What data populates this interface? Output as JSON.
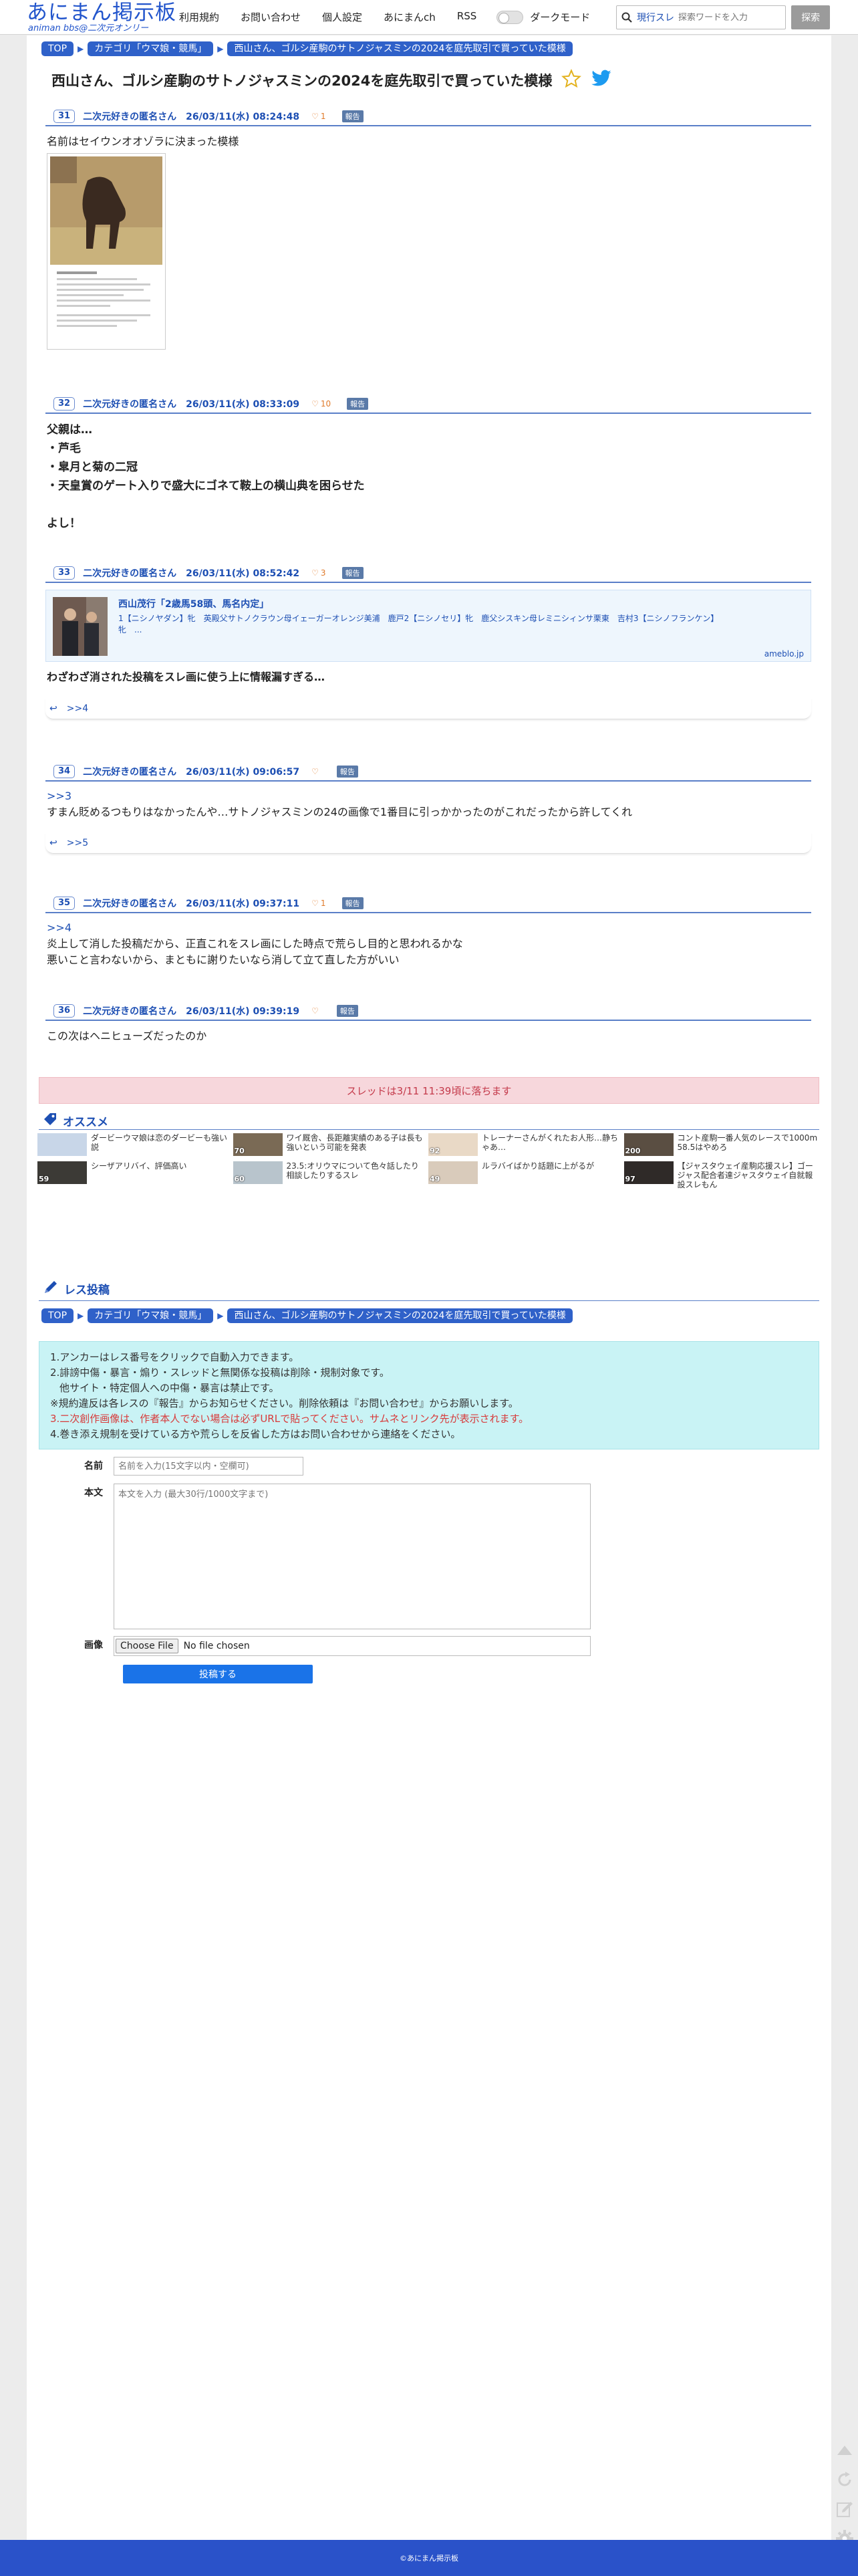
{
  "header": {
    "logo_main": "あにまん掲示板",
    "logo_sub": "animan bbs@二次元オンリー",
    "nav": [
      "利用規約",
      "お問い合わせ",
      "個人設定",
      "あにまんch",
      "RSS"
    ],
    "dark_mode": "ダークモード",
    "search_select": "現行スレ",
    "search_placeholder": "探索ワードを入力",
    "search_button": "探索"
  },
  "breadcrumb": {
    "top": "TOP",
    "category": "カテゴリ「ウマ娘・競馬」",
    "thread": "西山さん、ゴルシ産駒のサトノジャスミンの2024を庭先取引で買っていた模様"
  },
  "thread_title": "西山さん、ゴルシ産駒のサトノジャスミンの2024を庭先取引で買っていた模様",
  "report_label": "報告",
  "posts": [
    {
      "no": "31",
      "name": "二次元好きの匿名さん",
      "date": "26/03/11(水) 08:24:48",
      "likes": "1",
      "lines": [
        "名前はセイウンオオゾラに決まった模様"
      ]
    },
    {
      "no": "32",
      "name": "二次元好きの匿名さん",
      "date": "26/03/11(水) 08:33:09",
      "likes": "10",
      "lines": [
        "父親は…",
        "・芦毛",
        "・皐月と菊の二冠",
        "・天皇賞のゲート入りで盛大にゴネて鞍上の横山典を困らせた",
        "",
        "よし！"
      ]
    },
    {
      "no": "33",
      "name": "二次元好きの匿名さん",
      "date": "26/03/11(水) 08:52:42",
      "likes": "3",
      "lines": [
        "わざわざ消された投稿をスレ画に使う上に情報漏すぎる…"
      ],
      "reply": ">>4"
    },
    {
      "no": "34",
      "name": "二次元好きの匿名さん",
      "date": "26/03/11(水) 09:06:57",
      "likes": "",
      "anchor": ">>3",
      "lines": [
        "すまん貶めるつもりはなかったんや…サトノジャスミンの24の画像で1番目に引っかかったのがこれだったから許してくれ"
      ],
      "reply": ">>5"
    },
    {
      "no": "35",
      "name": "二次元好きの匿名さん",
      "date": "26/03/11(水) 09:37:11",
      "likes": "1",
      "anchor": ">>4",
      "lines": [
        "炎上して消した投稿だから、正直これをスレ画にした時点で荒らし目的と思われるかな",
        "悪いこと言わないから、まともに謝りたいなら消して立て直した方がいい"
      ]
    },
    {
      "no": "36",
      "name": "二次元好きの匿名さん",
      "date": "26/03/11(水) 09:39:19",
      "likes": "",
      "lines": [
        "この次はヘニヒューズだったのか"
      ]
    }
  ],
  "link_card": {
    "title": "西山茂行「2歳馬58頭、馬名内定」",
    "desc": "1【ニシノヤダン】牝　英殿父サトノクラウン母イェーガーオレンジ美浦　鹿戸2【ニシノセリ】牝　鹿父シスキン母レミニシィンサ栗東　吉村3【ニシノフランケン】牝　...",
    "domain": "ameblo.jp"
  },
  "falls_notice": "スレッドは3/11 11:39頃に落ちます",
  "recommend": {
    "heading": "オススメ",
    "items": [
      {
        "count": "",
        "title": "ダービーウマ娘は恋のダービーも強い説",
        "color": "#c8d6e8"
      },
      {
        "count": "70",
        "title": "ワイ厩舎、長距離実績のある子は長も強いという可能を発表",
        "color": "#7a6a55"
      },
      {
        "count": "92",
        "title": "トレーナーさんがくれたお人形…静ちゃあ…",
        "color": "#e9d9c6"
      },
      {
        "count": "200",
        "title": "コント産駒一番人気のレースで1000m 58.5はやめろ",
        "color": "#5a4e42"
      },
      {
        "count": "59",
        "title": "シーザアリバイ、評価高い",
        "color": "#3c3a36"
      },
      {
        "count": "60",
        "title": "23.5:オリウマについて色々話したり相談したりするスレ",
        "color": "#b8c4cc"
      },
      {
        "count": "49",
        "title": "ルラバイばかり話題に上がるが",
        "color": "#d9cbbb"
      },
      {
        "count": "97",
        "title": "【ジャスタウェイ産駒応援スレ】ゴージャス配合者達ジャスタウェイ自就報設スレもん",
        "color": "#2f2a28"
      }
    ]
  },
  "reply_form": {
    "heading": "レス投稿",
    "notices": [
      "1.アンカーはレス番号をクリックで自動入力できます。",
      "2.誹謗中傷・暴言・煽り・スレッドと無関係な投稿は削除・規制対象です。",
      "他サイト・特定個人への中傷・暴言は禁止です。",
      "※規約違反は各レスの『報告』からお知らせください。削除依頼は『お問い合わせ』からお願いします。",
      "3.二次創作画像は、作者本人でない場合は必ずURLで貼ってください。サムネとリンク先が表示されます。",
      "4.巻き添え規制を受けている方や荒らしを反省した方はお問い合わせから連絡をください。"
    ],
    "name_label": "名前",
    "name_placeholder": "名前を入力(15文字以内・空欄可)",
    "body_label": "本文",
    "body_placeholder": "本文を入力 (最大30行/1000文字まで)",
    "image_label": "画像",
    "file_button": "Choose File",
    "file_status": "No file chosen",
    "submit": "投稿する"
  },
  "footer": "©あにまん掲示板"
}
